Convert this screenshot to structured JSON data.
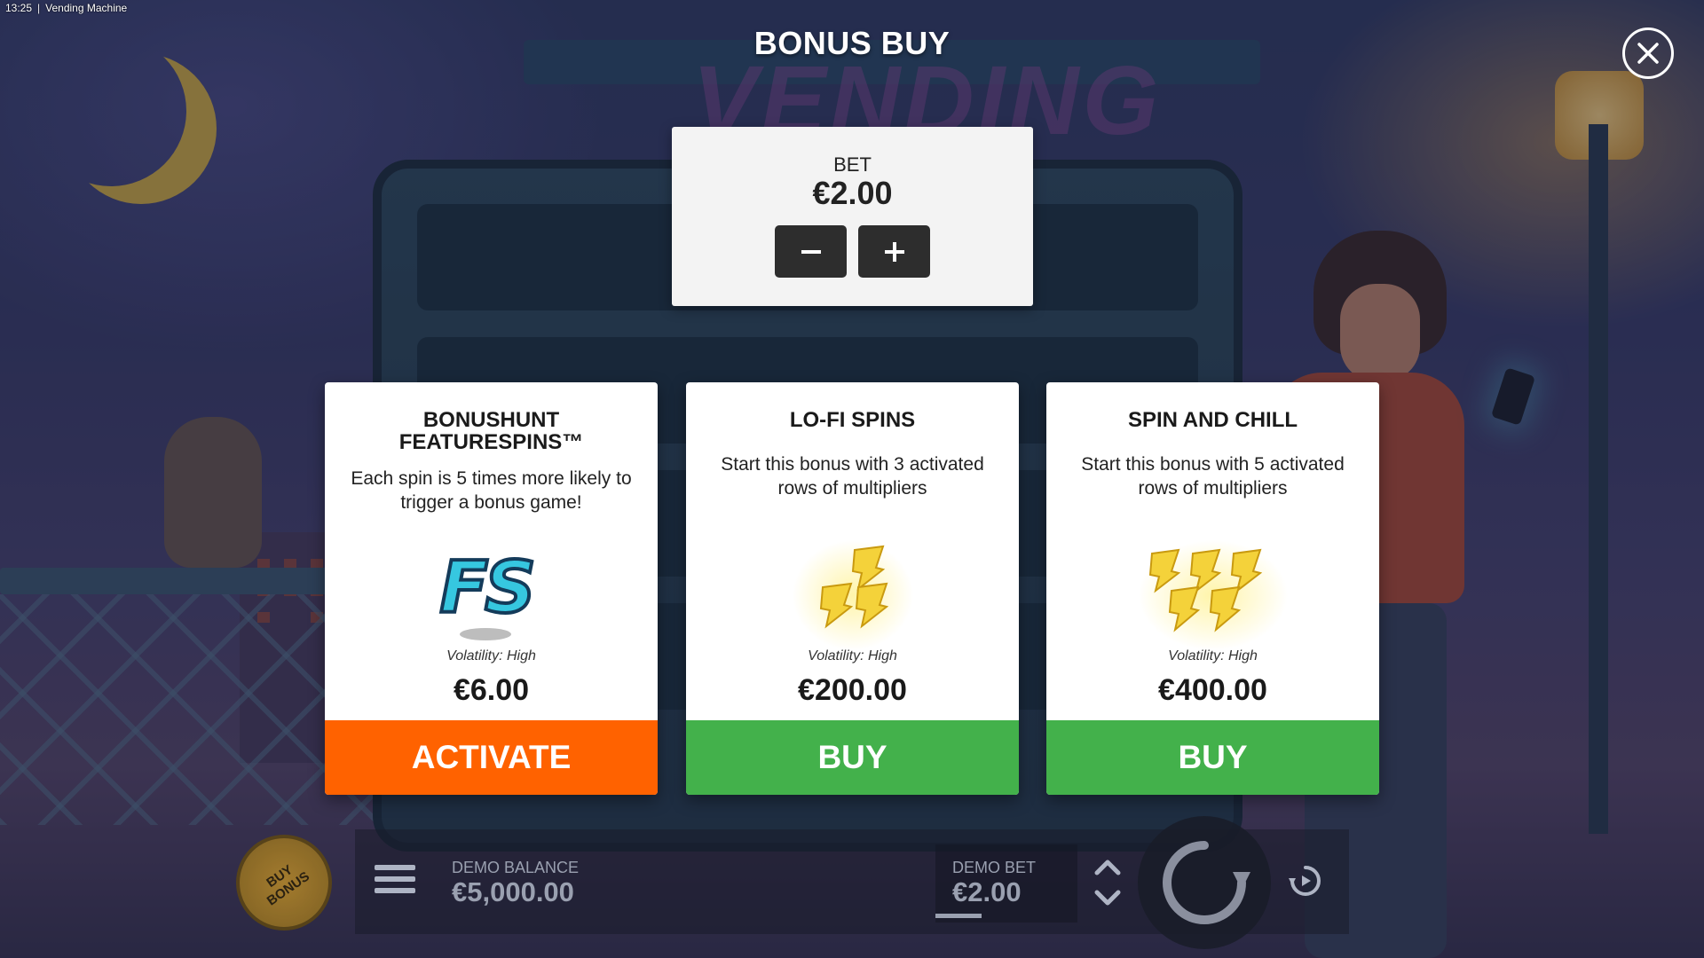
{
  "status_bar": {
    "time": "13:25",
    "separator": "|",
    "app_name": "Vending Machine"
  },
  "background": {
    "logo_text": "VENDING"
  },
  "dialog": {
    "title": "BONUS BUY",
    "close_icon": "close-icon",
    "bet": {
      "label": "BET",
      "value": "€2.00",
      "minus_icon": "minus-icon",
      "plus_icon": "plus-icon"
    },
    "cards": [
      {
        "title_line1": "BONUSHUNT",
        "title_line2": "FEATURESPINS™",
        "description": "Each spin is 5 times more likely to trigger a bonus game!",
        "icon_text": "FS",
        "icon": "fs-badge-icon",
        "volatility": "Volatility: High",
        "price": "€6.00",
        "action": "ACTIVATE",
        "action_color": "#ff6200"
      },
      {
        "title_line1": "LO-FI SPINS",
        "description": "Start this bonus with 3 activated rows of multipliers",
        "icon": "gold-multiplier-icon",
        "icon_count": 3,
        "volatility": "Volatility: High",
        "price": "€200.00",
        "action": "BUY",
        "action_color": "#43b14b"
      },
      {
        "title_line1": "SPIN AND CHILL",
        "description": "Start this bonus with 5 activated rows of multipliers",
        "icon": "gold-multiplier-icon",
        "icon_count": 5,
        "volatility": "Volatility: High",
        "price": "€400.00",
        "action": "BUY",
        "action_color": "#43b14b"
      }
    ]
  },
  "bottom_bar": {
    "buy_bonus_label_1": "BUY",
    "buy_bonus_label_2": "BONUS",
    "balance_label": "DEMO BALANCE",
    "balance_value": "€5,000.00",
    "bet_label": "DEMO BET",
    "bet_value": "€2.00",
    "menu_icon": "hamburger-menu-icon",
    "bet_arrows_icon": "chevron-up-down-icon",
    "spin_icon": "spin-arrow-icon",
    "autoplay_icon": "autoplay-icon"
  }
}
